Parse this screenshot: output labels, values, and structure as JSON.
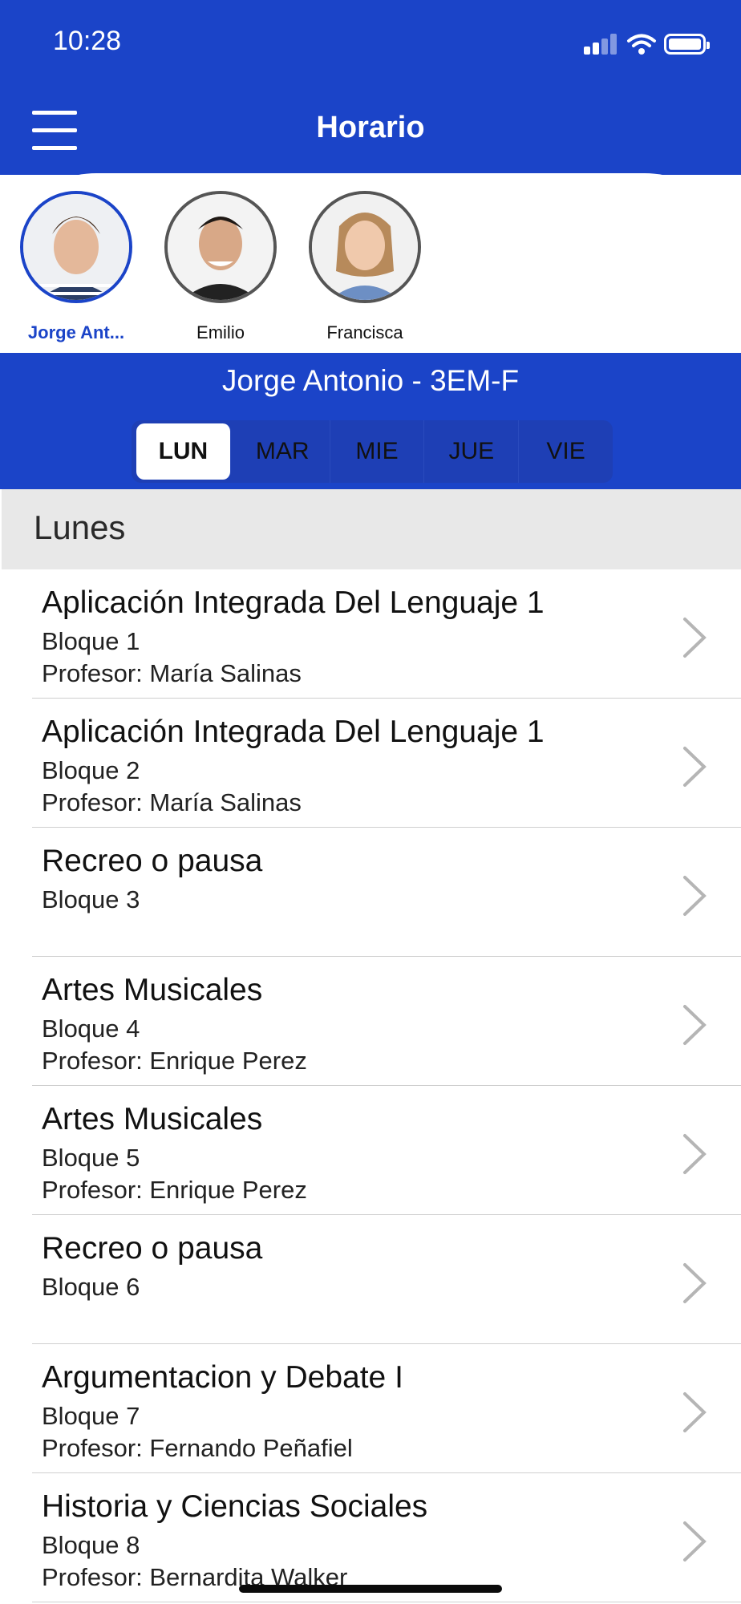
{
  "status": {
    "time": "10:28"
  },
  "header": {
    "title": "Horario"
  },
  "profiles": [
    {
      "name": "Jorge Ant...",
      "active": true
    },
    {
      "name": "Emilio",
      "active": false
    },
    {
      "name": "Francisca",
      "active": false
    }
  ],
  "student": {
    "label": "Jorge Antonio - 3EM-F"
  },
  "days": [
    "LUN",
    "MAR",
    "MIE",
    "JUE",
    "VIE"
  ],
  "selected_day": "LUN",
  "section": {
    "title": "Lunes"
  },
  "schedule": [
    {
      "subject": "Aplicación Integrada Del Lenguaje 1",
      "block": "Bloque 1",
      "teacher": "Profesor: María Salinas"
    },
    {
      "subject": "Aplicación Integrada Del Lenguaje 1",
      "block": "Bloque 2",
      "teacher": "Profesor: María Salinas"
    },
    {
      "subject": "Recreo o pausa",
      "block": "Bloque 3",
      "teacher": ""
    },
    {
      "subject": "Artes Musicales",
      "block": "Bloque 4",
      "teacher": "Profesor: Enrique Perez"
    },
    {
      "subject": "Artes Musicales",
      "block": "Bloque 5",
      "teacher": "Profesor: Enrique Perez"
    },
    {
      "subject": "Recreo o pausa",
      "block": "Bloque 6",
      "teacher": ""
    },
    {
      "subject": "Argumentacion y Debate I",
      "block": "Bloque 7",
      "teacher": "Profesor: Fernando Peñafiel"
    },
    {
      "subject": "Historia y Ciencias Sociales",
      "block": "Bloque 8",
      "teacher": "Profesor: Bernardita Walker"
    }
  ],
  "colors": {
    "primary": "#1b44c8",
    "section_bg": "#e8e8e8"
  }
}
